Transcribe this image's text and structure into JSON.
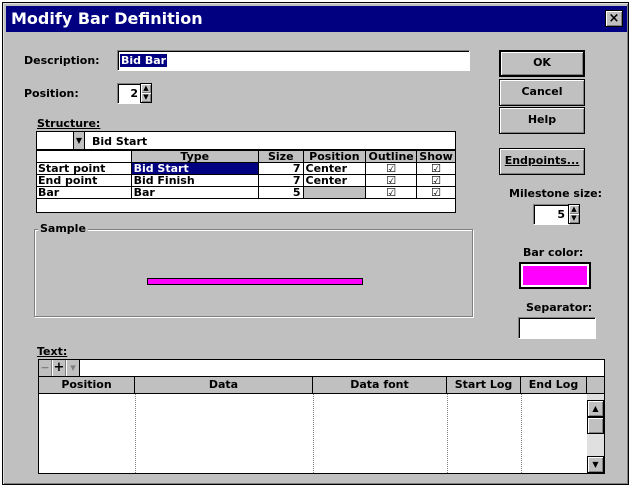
{
  "window": {
    "title": "Modify Bar Definition",
    "close_glyph": "×"
  },
  "description": {
    "label": "Description:",
    "value": "Bid Bar"
  },
  "position": {
    "label": "Position:",
    "value": "2"
  },
  "structure": {
    "label": "Structure:",
    "dropdown_value": "Bid Start",
    "columns": [
      "Type",
      "Size",
      "Position",
      "Outline",
      "Show"
    ],
    "rows": [
      {
        "name": "Start point",
        "type": "Bid Start",
        "size": "7",
        "position": "Center",
        "outline": "☑",
        "show": "☑"
      },
      {
        "name": "End point",
        "type": "Bid Finish",
        "size": "7",
        "position": "Center",
        "outline": "☑",
        "show": "☑"
      },
      {
        "name": "Bar",
        "type": "Bar",
        "size": "5",
        "position": "",
        "outline": "☑",
        "show": "☑"
      }
    ]
  },
  "sample": {
    "label": "Sample",
    "bar_color": "#ff00ff"
  },
  "buttons": {
    "ok": "OK",
    "cancel": "Cancel",
    "help": "Help",
    "endpoints": "Endpoints..."
  },
  "milestone": {
    "label": "Milestone size:",
    "value": "5"
  },
  "bar_color": {
    "label": "Bar color:",
    "value": "#ff00ff"
  },
  "separator": {
    "label": "Separator:",
    "value": ""
  },
  "text_section": {
    "label": "Text:",
    "toolbar": {
      "minus": "−",
      "plus": "+",
      "dropdown": "▾"
    },
    "columns": [
      "Position",
      "Data",
      "Data font",
      "Start Log",
      "End Log"
    ]
  },
  "colors": {
    "title_bg": "#000080",
    "selection": "#000080",
    "face": "#c0c0c0"
  }
}
